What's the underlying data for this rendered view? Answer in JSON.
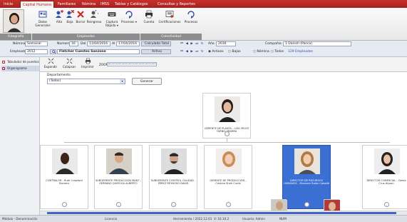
{
  "tabs": [
    {
      "label": "Inicio",
      "active": false
    },
    {
      "label": "Capital Humano",
      "active": true
    },
    {
      "label": "Familiares",
      "active": false
    },
    {
      "label": "Nómina",
      "active": false
    },
    {
      "label": "IMSS",
      "active": false
    },
    {
      "label": "Tablas y Catálogos",
      "active": false
    },
    {
      "label": "Consultas y Reportes",
      "active": false
    }
  ],
  "ribbon": {
    "buttons": [
      {
        "label": "Datos Generales",
        "icon": "id-card-icon"
      },
      {
        "label": "Alta",
        "icon": "add-person-icon"
      },
      {
        "label": "Baja",
        "icon": "remove-person-icon"
      },
      {
        "label": "Borrar",
        "icon": "delete-icon"
      },
      {
        "label": "Reingreso",
        "icon": "reentry-icon"
      },
      {
        "label": "Captura Rápida ▾",
        "icon": "keyboard-icon"
      },
      {
        "label": "Procesos ▾",
        "icon": "process-icon"
      },
      {
        "label": "Cuenta",
        "icon": "printer-icon"
      },
      {
        "label": "Certificaciones",
        "icon": "certificate-icon"
      },
      {
        "label": "Procesos",
        "icon": "gear-process-icon"
      }
    ],
    "groups": {
      "fotografia": "Fotografía",
      "empleados": "Empleados",
      "colectividad": "Colectividad"
    }
  },
  "filters": {
    "nomina_label": "Nómina",
    "nomina_value": "Semanal",
    "numero_label": "Número",
    "numero_value": "16",
    "del_label": "Del",
    "del_value": "11/04/2016",
    "al_label": "Al",
    "al_value": "17/04/2016",
    "calc_label": "Calculada Total",
    "anio_label": "Año",
    "anio_value": "2016",
    "compania_label": "Compañía",
    "compania_value": "1 Danish (Panca)",
    "empleado_label": "Empleado",
    "empleado_value": "2012",
    "empleado_name": "Fletcher Cuestes Sanzone",
    "status_value": "Activo",
    "activos_label": "Activos",
    "bajas_label": "Bajas",
    "nomina_opt": "Nómina",
    "todos_label": "Todos",
    "count_value": "129 Empleados"
  },
  "sidenav": {
    "items": [
      {
        "label": "Tabulador de puestos"
      },
      {
        "label": "Organigrama"
      }
    ]
  },
  "subbar": {
    "expandir": "Expandir",
    "colapsar": "Colapsar",
    "imprimir": "Imprimir",
    "zoom_label": "ZOOM"
  },
  "org": {
    "departamento_label": "Departamento",
    "departamento_value": "(Todos)",
    "generar_label": "Generar",
    "root": {
      "caption": "GERENTE DE PLANTA - LIZA VELEZ TARNIS YBARRA"
    },
    "children": [
      {
        "caption": "CONTRALOR - Ruth Crawford Stevens"
      },
      {
        "caption": "SUBGERENTE PRODUCCIÓN MANT - SERRANO QUIROGA ALBERTO"
      },
      {
        "caption": "SUBGERENTE CONTROL CALIDAD - PÉREZ REYNOSO DAVID"
      },
      {
        "caption": "GERENTE DE PRODUCCIÓN - Cristina Shah Curtis"
      },
      {
        "caption": "DIRECTOR DE RECURSOS HUMANOS - Maureen Rabin Caballé"
      },
      {
        "caption": "DIRECTOR COMERCIAL - Gema Cruz Alyson"
      }
    ]
  },
  "status": {
    "left": "Módulo - Denominación",
    "license": "Licencia",
    "version": "Herramienta / 2022.12.01",
    "ip": "V: 10.10.2",
    "user": "Usuario: Admin",
    "num": "NUM"
  }
}
